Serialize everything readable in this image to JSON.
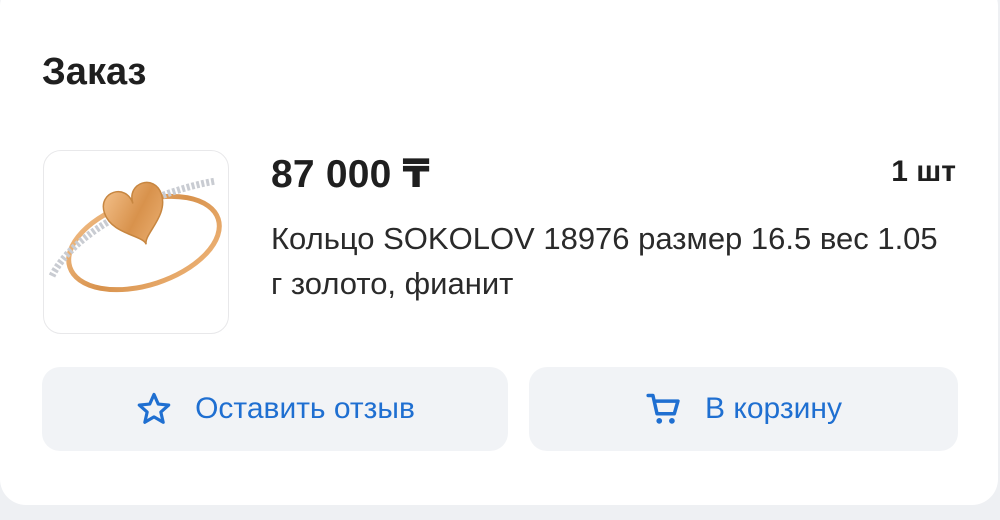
{
  "order": {
    "title": "Заказ",
    "price": "87 000 ₸",
    "quantity": "1 шт",
    "description": "Кольцо SOKOLOV 18976 размер 16.5 вес 1.05 г золото, фианит"
  },
  "actions": {
    "review_label": "Оставить отзыв",
    "review_icon": "star-outline-icon",
    "cart_label": "В корзину",
    "cart_icon": "cart-icon"
  },
  "colors": {
    "accent": "#1f6fd1",
    "button_bg": "#f1f3f6",
    "text": "#1f1f1f"
  }
}
